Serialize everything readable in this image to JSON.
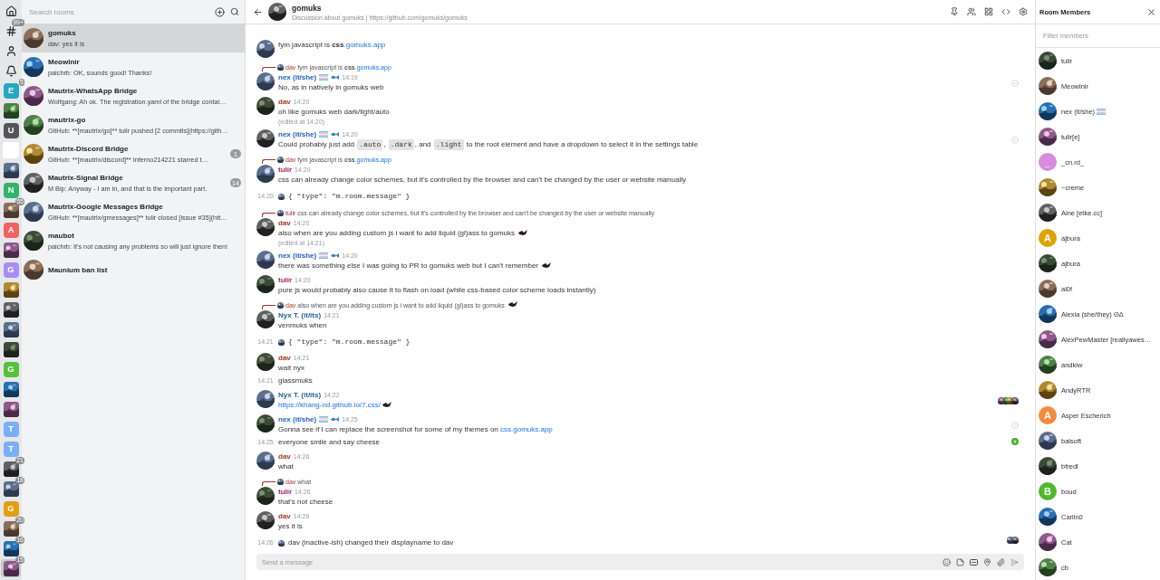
{
  "spaces": [
    {
      "kind": "home",
      "selected": false
    },
    {
      "kind": "hash",
      "badge": "99+",
      "selected": false
    },
    {
      "kind": "person",
      "selected": false
    },
    {
      "kind": "bell",
      "selected": false
    },
    {
      "kind": "letter",
      "letter": "E",
      "color": "#25a8c2",
      "badge": "5",
      "selected": false
    },
    {
      "kind": "picture",
      "selected": false
    },
    {
      "kind": "letter",
      "letter": "U",
      "color": "#555555",
      "selected": false
    },
    {
      "kind": "blank",
      "selected": false
    },
    {
      "kind": "picture",
      "selected": false
    },
    {
      "kind": "letter",
      "letter": "N",
      "color": "#2fb36d",
      "selected": false
    },
    {
      "kind": "picture",
      "badge": "55",
      "selected": false
    },
    {
      "kind": "letter",
      "letter": "A",
      "color": "#f0625e",
      "selected": false
    },
    {
      "kind": "picture",
      "selected": false
    },
    {
      "kind": "letter",
      "letter": "G",
      "color": "#a88ef0",
      "selected": false
    },
    {
      "kind": "picture",
      "selected": false
    },
    {
      "kind": "picture",
      "selected": false
    },
    {
      "kind": "picture",
      "selected": false
    },
    {
      "kind": "picture",
      "selected": false
    },
    {
      "kind": "letter",
      "letter": "G",
      "color": "#55c23a",
      "selected": false
    },
    {
      "kind": "picture",
      "selected": false
    },
    {
      "kind": "picture",
      "selected": false
    },
    {
      "kind": "letter",
      "letter": "T",
      "color": "#7aaef5",
      "selected": false
    },
    {
      "kind": "letter",
      "letter": "T",
      "color": "#7aaef5",
      "selected": false
    },
    {
      "kind": "picture",
      "badge": "21",
      "selected": false
    },
    {
      "kind": "picture",
      "badge": "18",
      "selected": false
    },
    {
      "kind": "letter",
      "letter": "G",
      "color": "#e0a010",
      "selected": false
    },
    {
      "kind": "picture",
      "badge": "20",
      "selected": false
    },
    {
      "kind": "picture",
      "badge": "16",
      "selected": false
    },
    {
      "kind": "picture",
      "badge": "15",
      "selected": true
    }
  ],
  "room_list": {
    "search": {
      "placeholder": "Search rooms"
    },
    "rooms": [
      {
        "name": "gomuks",
        "preview": "dav: yes it is",
        "selected": true
      },
      {
        "name": "Meowlnir",
        "preview": "palchrb: OK, sounds good! Thanks!",
        "selected": false
      },
      {
        "name": "Mautrix-WhatsApp Bridge",
        "preview": "Wolfgang: Ah ok. The registration.yaml of the bridge contai…",
        "selected": false
      },
      {
        "name": "mautrix-go",
        "preview": "GitHub: **[mautrix/go]** tulir pushed [2 commits](https://gith…",
        "selected": false
      },
      {
        "name": "Mautrix-Discord Bridge",
        "preview": "GitHub: **[mautrix/discord]** Inferno214221 starred t…",
        "unread": "1",
        "selected": false
      },
      {
        "name": "Mautrix-Signal Bridge",
        "preview": "M Bip: Anyway - I am in, and that is the important part.",
        "unread": "14",
        "selected": false
      },
      {
        "name": "Mautrix-Google Messages Bridge",
        "preview": "GitHub: **[mautrix/gmessages]** tulir closed [issue #35](htt…",
        "selected": false
      },
      {
        "name": "maubot",
        "preview": "palchrb: It's not causing any problems so will just ignore then!",
        "selected": false
      },
      {
        "name": "Maunium ban list",
        "selected": false
      }
    ]
  },
  "room_header": {
    "title": "gomuks",
    "topic": "Discussion about gomuks | https://github.com/gomuks/gomuks"
  },
  "timeline": [
    {
      "kind": "tail",
      "body": [
        {
          "kind": "text",
          "text": "fym javascript is "
        },
        {
          "kind": "bold",
          "text": "css"
        },
        {
          "kind": "link",
          "text": ".gomuks.app"
        }
      ]
    },
    {
      "kind": "message",
      "sender": "nex (it/she)",
      "color": "#1c5fc4",
      "badges": [
        {
          "kind": "flag"
        },
        {
          "kind": "fish"
        }
      ],
      "time": "14:19",
      "reply": {
        "sender": "dav",
        "color": "#a8341f",
        "body": [
          {
            "kind": "text",
            "text": "fym javascript is "
          },
          {
            "kind": "bold",
            "text": "css"
          },
          {
            "kind": "link",
            "text": ".gomuks.app"
          }
        ]
      },
      "body": [
        {
          "kind": "text",
          "text": "No, as in natively in gomuks web"
        }
      ],
      "receipt": {
        "kind": "check"
      }
    },
    {
      "kind": "message",
      "sender": "dav",
      "color": "#a8341f",
      "time": "14:20",
      "body": [
        {
          "kind": "text",
          "text": "oh like gomuks web dark/light/auto"
        }
      ],
      "edited": "(edited at 14:20)"
    },
    {
      "kind": "message",
      "sender": "nex (it/she)",
      "color": "#1c5fc4",
      "badges": [
        {
          "kind": "flag"
        },
        {
          "kind": "fish"
        }
      ],
      "time": "14:20",
      "body": [
        {
          "kind": "text",
          "text": "Could probably just add "
        },
        {
          "kind": "code",
          "text": ".auto"
        },
        {
          "kind": "text",
          "text": ", "
        },
        {
          "kind": "code",
          "text": ".dark"
        },
        {
          "kind": "text",
          "text": ", and "
        },
        {
          "kind": "code",
          "text": ".light"
        },
        {
          "kind": "text",
          "text": " to the root element and have a dropdown to select it in the settings table"
        }
      ],
      "receipt": {
        "kind": "check"
      }
    },
    {
      "kind": "message",
      "sender": "tulir",
      "color": "#a3215c",
      "time": "14:20",
      "reply": {
        "sender": "dav",
        "color": "#a8341f",
        "body": [
          {
            "kind": "text",
            "text": "fym javascript is "
          },
          {
            "kind": "bold",
            "text": "css"
          },
          {
            "kind": "link",
            "text": ".gomuks.app"
          }
        ]
      },
      "body": [
        {
          "kind": "text",
          "text": "css can already change color schemes, but it's controlled by the browser and can't be changed by the user or website manually"
        }
      ]
    },
    {
      "kind": "code",
      "time": "14:20",
      "code": "{ \"type\": \"m.room.message\" }"
    },
    {
      "kind": "message",
      "sender": "dav",
      "color": "#a8341f",
      "time": "14:20",
      "reply": {
        "sender": "tulir",
        "color": "#a3215c",
        "body": [
          {
            "kind": "text",
            "text": "css can already change color schemes, but it's controlled by the browser and can't be changed by the user or website manually"
          }
        ]
      },
      "body": [
        {
          "kind": "text",
          "text": "also when are you adding custom js i want to add liquid (gl)ass to gomuks "
        },
        {
          "kind": "emoji"
        }
      ],
      "edited": "(edited at 14:21)"
    },
    {
      "kind": "message",
      "sender": "nex (it/she)",
      "color": "#1c5fc4",
      "badges": [
        {
          "kind": "flag"
        },
        {
          "kind": "fish"
        }
      ],
      "time": "14:20",
      "body": [
        {
          "kind": "text",
          "text": "there was something else I was going to PR to gomuks web but I can't remember "
        },
        {
          "kind": "emoji"
        }
      ]
    },
    {
      "kind": "message",
      "sender": "tulir",
      "color": "#a3215c",
      "time": "14:20",
      "body": [
        {
          "kind": "text",
          "text": "pure js would probably also cause it to flash on load (while css-based color scheme loads instantly)"
        }
      ]
    },
    {
      "kind": "message",
      "sender": "Nyx T. (it/its)",
      "color": "#1f5f95",
      "time": "14:21",
      "reply": {
        "sender": "dav",
        "color": "#a8341f",
        "body": [
          {
            "kind": "text",
            "text": "also when are you adding custom js i want to add liquid (gl)ass to gomuks "
          },
          {
            "kind": "emoji"
          }
        ]
      },
      "body": [
        {
          "kind": "text",
          "text": "venmuks when"
        }
      ]
    },
    {
      "kind": "code",
      "time": "14:21",
      "code": "{ \"type\": \"m.room.message\" }"
    },
    {
      "kind": "message",
      "sender": "dav",
      "color": "#a8341f",
      "time": "14:21",
      "body": [
        {
          "kind": "text",
          "text": "wait nyx"
        }
      ]
    },
    {
      "kind": "continuation",
      "time": "14:21",
      "body": [
        {
          "kind": "text",
          "text": "glassmuks"
        }
      ]
    },
    {
      "kind": "message",
      "sender": "Nyx T. (it/its)",
      "color": "#1f5f95",
      "time": "14:22",
      "body": [
        {
          "kind": "link",
          "text": "https://khang-nd.github.io/7.css/"
        },
        {
          "kind": "emoji"
        }
      ],
      "receipt": {
        "kind": "group"
      }
    },
    {
      "kind": "message",
      "sender": "nex (it/she)",
      "color": "#1c5fc4",
      "badges": [
        {
          "kind": "flag"
        },
        {
          "kind": "fish"
        }
      ],
      "time": "14:25",
      "body": [
        {
          "kind": "text",
          "text": "Gonna see if I can replace the screenshot for some of my themes on "
        },
        {
          "kind": "link",
          "text": "css.gomuks.app"
        }
      ],
      "receipt": {
        "kind": "check"
      }
    },
    {
      "kind": "continuation",
      "time": "14:25",
      "body": [
        {
          "kind": "text",
          "text": "everyone smile and say cheese"
        }
      ],
      "receipt": {
        "kind": "green"
      }
    },
    {
      "kind": "message",
      "sender": "dav",
      "color": "#a8341f",
      "time": "14:26",
      "body": [
        {
          "kind": "text",
          "text": "what"
        }
      ]
    },
    {
      "kind": "message",
      "sender": "tulir",
      "color": "#a3215c",
      "time": "14:26",
      "reply": {
        "sender": "dav",
        "color": "#a8341f",
        "body": [
          {
            "kind": "text",
            "text": "what"
          }
        ]
      },
      "body": [
        {
          "kind": "text",
          "text": "that's not cheese"
        }
      ]
    },
    {
      "kind": "message",
      "sender": "dav",
      "color": "#a8341f",
      "time": "14:26",
      "body": [
        {
          "kind": "text",
          "text": "yes it is"
        }
      ]
    },
    {
      "kind": "state",
      "time": "14:26",
      "text": "dav (inactive-ish) changed their displayname to dav",
      "receipt": {
        "kind": "pair"
      }
    }
  ],
  "composer": {
    "placeholder": "Send a message"
  },
  "members": {
    "title": "Room Members",
    "filter": {
      "placeholder": "Filter members"
    },
    "list": [
      {
        "name": "tulir",
        "kind": "picture"
      },
      {
        "name": "Meowlnir",
        "kind": "picture"
      },
      {
        "name": "nex (it/she)",
        "kind": "picture",
        "badges": [
          {
            "kind": "flag"
          }
        ]
      },
      {
        "name": "tulir[e]",
        "kind": "picture"
      },
      {
        "name": "_cn.rd_",
        "kind": "letter",
        "letter": "_",
        "color": "#d98be0"
      },
      {
        "name": "~creme",
        "kind": "picture"
      },
      {
        "name": "Aine [etke.cc]",
        "kind": "picture"
      },
      {
        "name": "ajbura",
        "kind": "letter",
        "letter": "A",
        "color": "#dfa300"
      },
      {
        "name": "ajbura",
        "kind": "picture"
      },
      {
        "name": "al0f",
        "kind": "picture"
      },
      {
        "name": "Alexia (she/they) ΘΔ",
        "kind": "picture"
      },
      {
        "name": "AlexPewMaster [reallyawes…",
        "kind": "picture"
      },
      {
        "name": "andkiw",
        "kind": "picture"
      },
      {
        "name": "AndyRTR",
        "kind": "picture"
      },
      {
        "name": "Asper Escherich",
        "kind": "letter",
        "letter": "A",
        "color": "#f58b3c"
      },
      {
        "name": "balsoft",
        "kind": "picture"
      },
      {
        "name": "bfredl",
        "kind": "picture"
      },
      {
        "name": "boud",
        "kind": "letter",
        "letter": "B",
        "color": "#4fba2b"
      },
      {
        "name": "Carlin0",
        "kind": "picture"
      },
      {
        "name": "Cat",
        "kind": "picture"
      },
      {
        "name": "cb",
        "kind": "picture"
      }
    ]
  }
}
